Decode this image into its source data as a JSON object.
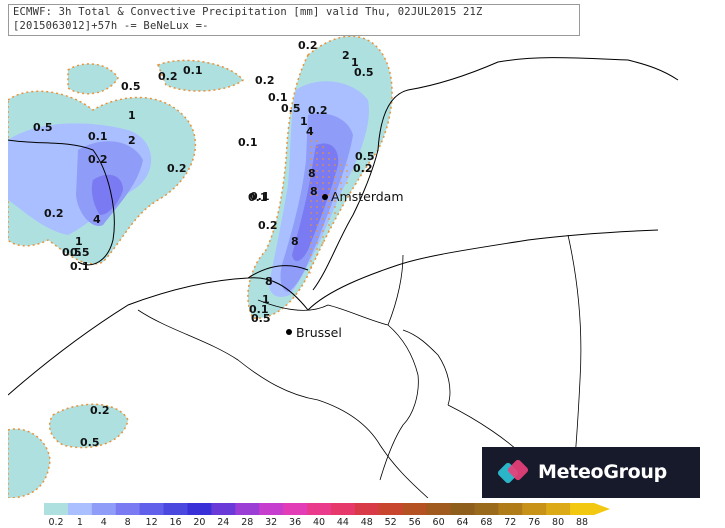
{
  "header": {
    "line1": "ECMWF: 3h Total & Convective Precipitation [mm] valid Thu, 02JUL2015 21Z",
    "line2": "[2015063012]+57h -= BeNeLux =-"
  },
  "cities": [
    {
      "name": "Amsterdam"
    },
    {
      "name": "Brussel"
    }
  ],
  "brand": {
    "name": "MeteoGroup",
    "background": "#171a2b"
  },
  "contour_labels": [
    "0.2",
    "2",
    "1",
    "0.5",
    "0.2",
    "0.1",
    "0.5",
    "0.2",
    "0.5",
    "1",
    "2",
    "0.1",
    "0.2",
    "0.2",
    "0.1",
    "0.1",
    "0.5",
    "0.2",
    "1",
    "4",
    "0.5",
    "0.5",
    "0.2",
    "0.2",
    "4",
    "1",
    "0.5",
    "0.1",
    "0.1",
    "8",
    "8",
    "0.1",
    "0.2",
    "8",
    "8",
    "1",
    "0.5",
    "0.1",
    "0.2",
    "0.5"
  ],
  "legend": {
    "levels": [
      "0.2",
      "1",
      "4",
      "8",
      "12",
      "16",
      "20",
      "24",
      "28",
      "32",
      "36",
      "40",
      "44",
      "48",
      "52",
      "56",
      "60",
      "64",
      "68",
      "72",
      "76",
      "80",
      "88"
    ],
    "colors": [
      "#aee0e0",
      "#a9bfff",
      "#8f9cf8",
      "#7a7af2",
      "#6060ea",
      "#4b48e0",
      "#3a30d8",
      "#6a3ad8",
      "#9a3ed6",
      "#c63ece",
      "#e23cb6",
      "#ea3a8c",
      "#e6386a",
      "#d83a48",
      "#c8462e",
      "#b45224",
      "#a05a1e",
      "#8e5e1c",
      "#9a6a1c",
      "#b07c1a",
      "#c89218",
      "#dcaa16",
      "#f2c810"
    ]
  },
  "colors": {
    "lightest": "#aee0e0",
    "light": "#a9bfff",
    "mid": "#8f9cf8",
    "dark": "#7a7af2",
    "contour": "#e8923a"
  }
}
